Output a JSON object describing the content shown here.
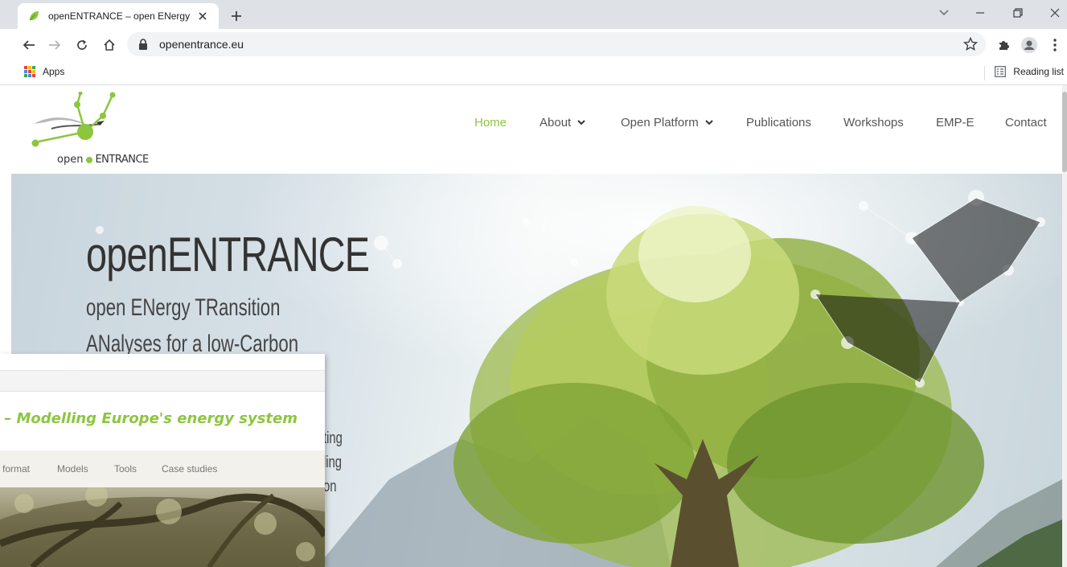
{
  "browser": {
    "tab_title": "openENTRANCE – open ENergy TRansition ANalyses",
    "url": "openentrance.eu",
    "bookmarks": {
      "apps_label": "Apps",
      "reading_list_label": "Reading list"
    }
  },
  "site": {
    "logo": {
      "word1": "open",
      "word2": "ENTRANCE"
    },
    "nav": [
      {
        "label": "Home",
        "active": true,
        "has_dropdown": false
      },
      {
        "label": "About",
        "active": false,
        "has_dropdown": true
      },
      {
        "label": "Open Platform",
        "active": false,
        "has_dropdown": true
      },
      {
        "label": "Publications",
        "active": false,
        "has_dropdown": false
      },
      {
        "label": "Workshops",
        "active": false,
        "has_dropdown": false
      },
      {
        "label": "EMP-E",
        "active": false,
        "has_dropdown": false
      },
      {
        "label": "Contact",
        "active": false,
        "has_dropdown": false
      }
    ],
    "hero": {
      "title": "openENTRANCE",
      "subtitle_line1": "open ENergy TRansition",
      "subtitle_line2": "ANalyses for a low-Carbon",
      "fragments": [
        "ting",
        "ling",
        "on"
      ]
    },
    "colors": {
      "accent_green": "#8cc63f",
      "nav_text": "#555555"
    }
  },
  "overlay_window": {
    "headline": "– Modelling Europe's energy system",
    "menu": [
      "format",
      "Models",
      "Tools",
      "Case studies"
    ]
  }
}
